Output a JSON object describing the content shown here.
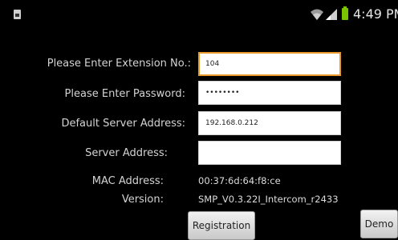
{
  "status_bar": {
    "time": "4:49 PM",
    "icons": [
      "sim-card-icon",
      "wifi-icon",
      "signal-icon",
      "battery-icon"
    ],
    "battery_color": "#7bc400"
  },
  "form": {
    "extension_label": "Please Enter Extension No.:",
    "extension_value": "104",
    "password_label": "Please Enter Password:",
    "password_value": "••••••••",
    "default_server_label": "Default Server Address:",
    "default_server_value": "192.168.0.212",
    "server_label": "Server Address:",
    "server_value": ""
  },
  "info": {
    "mac_label": "MAC Address:",
    "mac_value": "00:37:6d:64:f8:ce",
    "version_label": "Version:",
    "version_value": "SMP_V0.3.22I_Intercom_r2433"
  },
  "buttons": {
    "registration": "Registration",
    "demo": "Demo"
  },
  "colors": {
    "background": "#000000",
    "focus_border": "#e89b2a"
  }
}
